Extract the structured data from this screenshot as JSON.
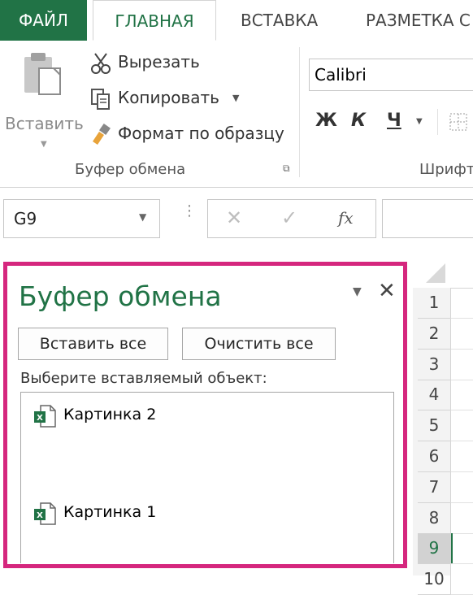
{
  "tabs": {
    "file": "ФАЙЛ",
    "home": "ГЛАВНАЯ",
    "insert": "ВСТАВКА",
    "layout": "РАЗМЕТКА С"
  },
  "clipboard_group": {
    "paste": "Вставить",
    "cut": "Вырезать",
    "copy": "Копировать",
    "format_painter": "Формат по образцу",
    "label": "Буфер обмена"
  },
  "font_group": {
    "font_name": "Calibri",
    "bold": "Ж",
    "italic": "К",
    "underline": "Ч",
    "label": "Шрифт"
  },
  "formula_bar": {
    "name_box": "G9",
    "cancel": "✕",
    "enter": "✓",
    "fx": "fx"
  },
  "row_headers": [
    "1",
    "2",
    "3",
    "4",
    "5",
    "6",
    "7",
    "8",
    "9",
    "10"
  ],
  "selected_row": "9",
  "pane": {
    "title": "Буфер обмена",
    "paste_all": "Вставить все",
    "clear_all": "Очистить все",
    "prompt": "Выберите вставляемый объект:",
    "items": [
      {
        "label": "Картинка 2",
        "icon": "excel-file-icon"
      },
      {
        "label": "Картинка 1",
        "icon": "excel-file-icon"
      }
    ]
  },
  "colors": {
    "excel_green": "#217346",
    "highlight_border": "#d5277e"
  }
}
